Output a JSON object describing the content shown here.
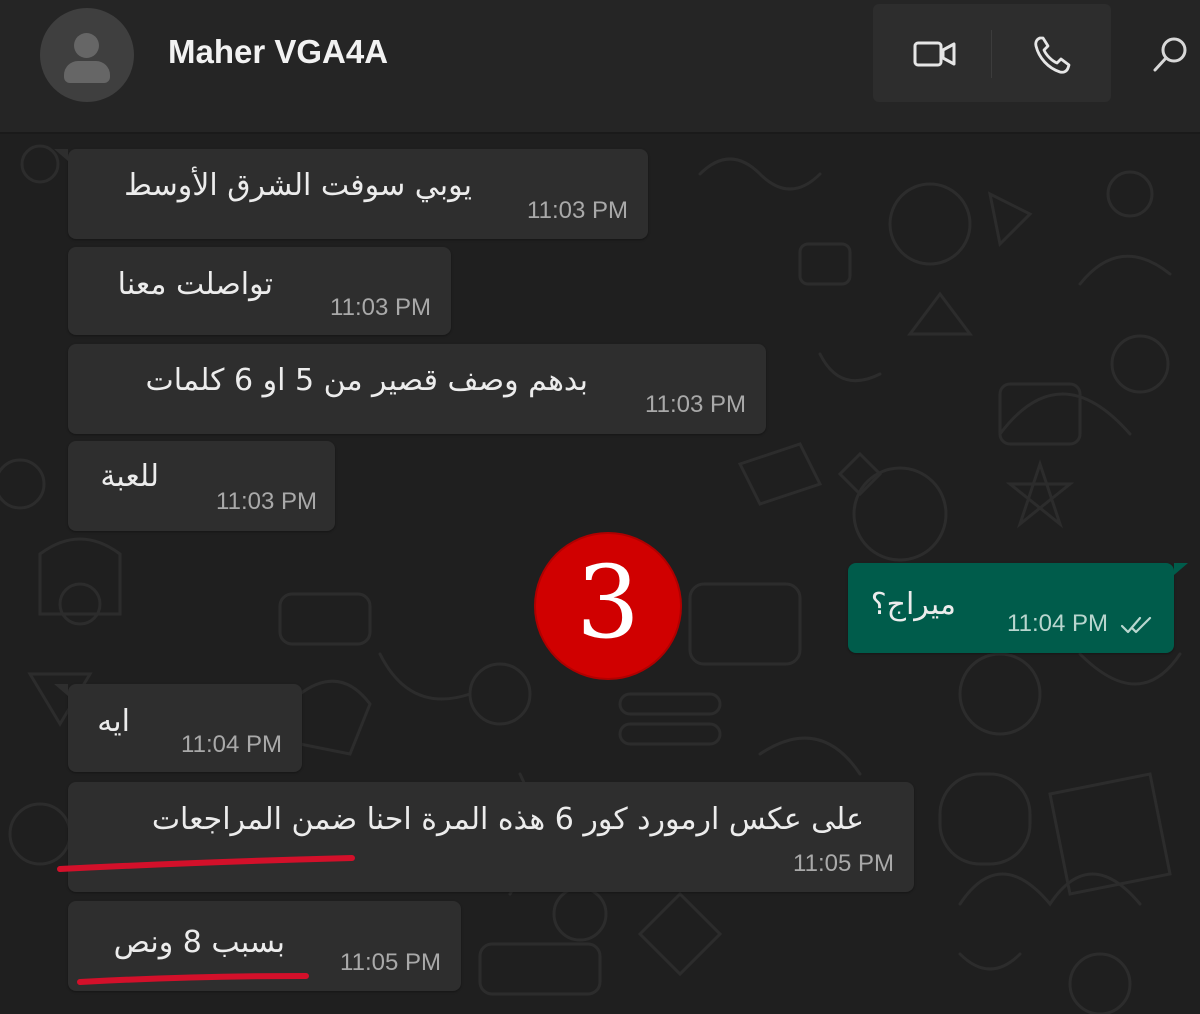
{
  "header": {
    "contact_name": "Maher VGA4A",
    "avatar_icon": "default-person-avatar-icon",
    "video_call_icon": "video-camera-icon",
    "voice_call_icon": "phone-icon",
    "search_icon": "search-icon"
  },
  "messages": [
    {
      "direction": "incoming",
      "text": "يوبي سوفت الشرق الأوسط",
      "time": "11:03 PM"
    },
    {
      "direction": "incoming",
      "text": "تواصلت معنا",
      "time": "11:03 PM"
    },
    {
      "direction": "incoming",
      "text": "بدهم وصف قصير من 5 او 6 كلمات",
      "time": "11:03 PM"
    },
    {
      "direction": "incoming",
      "text": "للعبة",
      "time": "11:03 PM"
    },
    {
      "direction": "outgoing",
      "text": "ميراج؟",
      "time": "11:04 PM",
      "status": "read-double-check"
    },
    {
      "direction": "incoming",
      "text": "ايه",
      "time": "11:04 PM"
    },
    {
      "direction": "incoming",
      "text": "على عكس ارمورد كور 6 هذه المرة احنا ضمن المراجعات",
      "time": "11:05 PM",
      "annotated": "red-underline"
    },
    {
      "direction": "incoming",
      "text": "بسبب 8 ونص",
      "time": "11:05 PM",
      "annotated": "red-underline"
    }
  ],
  "annotation": {
    "badge_number": "3",
    "badge_color": "#d00000",
    "underline_color": "#d3102a"
  },
  "colors": {
    "header_bg": "#252525",
    "chat_bg": "#1f1f1f",
    "incoming_bubble": "#2e2e2e",
    "outgoing_bubble": "#005c4b"
  }
}
